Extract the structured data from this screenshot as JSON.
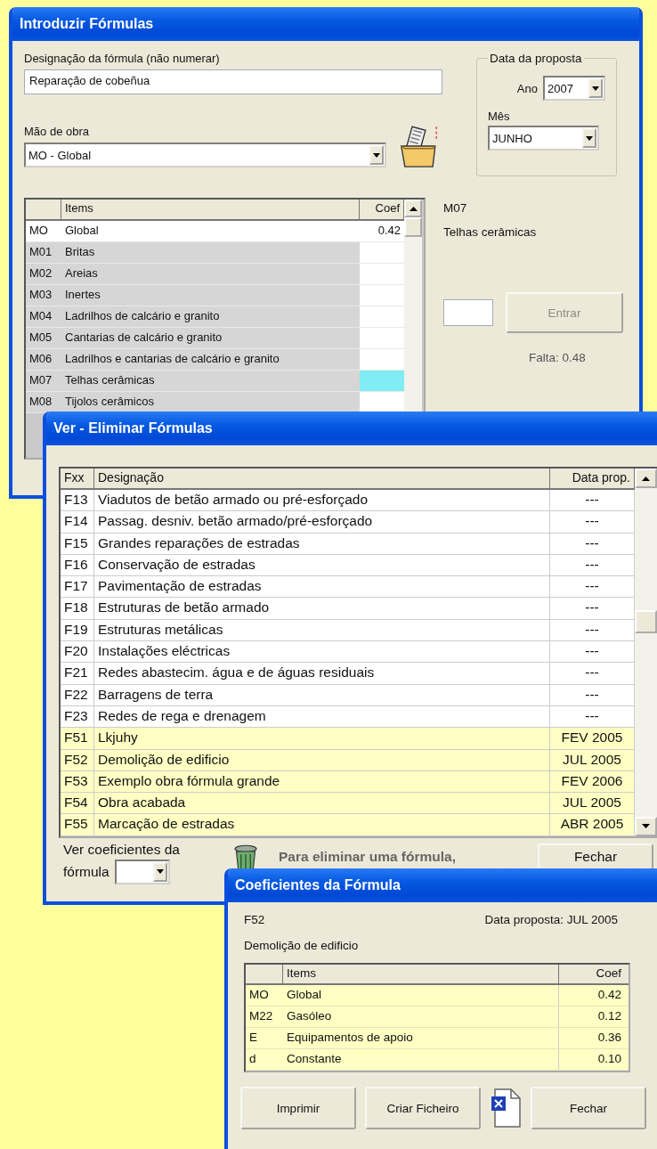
{
  "entry_window": {
    "title": "Introduzir Fórmulas",
    "name_label": "Designação da fórmula (não numerar)",
    "name_value": "Reparação de cobeñua",
    "labor_label": "Mão de obra",
    "labor_value": "MO - Global",
    "date_group": {
      "title": "Data da proposta",
      "year_label": "Ano",
      "year_value": "2007",
      "month_label": "Mês",
      "month_value": "JUNHO"
    },
    "items_table": {
      "columns": [
        "Items",
        "Coef"
      ],
      "rows": [
        {
          "code": "MO",
          "name": "Global",
          "coef": "0.42",
          "selected": false
        },
        {
          "code": "M01",
          "name": "Britas",
          "selected": false
        },
        {
          "code": "M02",
          "name": "Areias",
          "selected": false
        },
        {
          "code": "M03",
          "name": "Inertes",
          "selected": false
        },
        {
          "code": "M04",
          "name": "Ladrilhos de calcário e granito",
          "selected": false
        },
        {
          "code": "M05",
          "name": "Cantarias de calcário e granito",
          "selected": false
        },
        {
          "code": "M06",
          "name": "Ladrilhos e cantarias de calcário e granito",
          "selected": false
        },
        {
          "code": "M07",
          "name": "Telhas cerâmicas",
          "selected": true
        },
        {
          "code": "M08",
          "name": "Tijolos cerâmicos",
          "selected": false
        }
      ]
    },
    "current_item": {
      "code": "M07",
      "name": "Telhas cerâmicas"
    },
    "enter_button": {
      "label": "Entrar",
      "disabled": true
    },
    "remaining": "Falta: 0.48"
  },
  "list_window": {
    "title": "Ver - Eliminar Fórmulas",
    "columns": [
      "Fxx",
      "Designação",
      "Data prop."
    ],
    "rows": [
      {
        "code": "F13",
        "name": "Viadutos de betão armado ou pré-esforçado",
        "date": "---",
        "highlighted": false
      },
      {
        "code": "F14",
        "name": "Passag. desniv. betão armado/pré-esforçado",
        "date": "---",
        "highlighted": false
      },
      {
        "code": "F15",
        "name": "Grandes reparações de estradas",
        "date": "---",
        "highlighted": false
      },
      {
        "code": "F16",
        "name": "Conservação de estradas",
        "date": "---",
        "highlighted": false
      },
      {
        "code": "F17",
        "name": "Pavimentação de estradas",
        "date": "---",
        "highlighted": false
      },
      {
        "code": "F18",
        "name": "Estruturas de betão armado",
        "date": "---",
        "highlighted": false
      },
      {
        "code": "F19",
        "name": "Estruturas metálicas",
        "date": "---",
        "highlighted": false
      },
      {
        "code": "F20",
        "name": "Instalações eléctricas",
        "date": "---",
        "highlighted": false
      },
      {
        "code": "F21",
        "name": "Redes abastecim. água e de águas residuais",
        "date": "---",
        "highlighted": false
      },
      {
        "code": "F22",
        "name": "Barragens de terra",
        "date": "---",
        "highlighted": false
      },
      {
        "code": "F23",
        "name": "Redes de rega e drenagem",
        "date": "---",
        "highlighted": false
      },
      {
        "code": "F51",
        "name": "Lkjuhy",
        "date": "FEV 2005",
        "highlighted": true
      },
      {
        "code": "F52",
        "name": "Demolição de edificio",
        "date": "JUL 2005",
        "highlighted": true
      },
      {
        "code": "F53",
        "name": "Exemplo obra fórmula grande",
        "date": "FEV 2006",
        "highlighted": true
      },
      {
        "code": "F54",
        "name": "Obra acabada",
        "date": "JUL 2005",
        "highlighted": true
      },
      {
        "code": "F55",
        "name": "Marcação de estradas",
        "date": "ABR 2005",
        "highlighted": true
      }
    ],
    "view_label": "Ver coeficientes da",
    "view_label_2": "fórmula",
    "hint": "Para eliminar uma fórmula,",
    "close_button": "Fechar"
  },
  "coef_window": {
    "title": "Coeficientes da Fórmula",
    "code": "F52",
    "date": "Data proposta: JUL 2005",
    "name": "Demolição de edificio",
    "columns": [
      "Items",
      "Coef"
    ],
    "rows": [
      {
        "code": "MO",
        "name": "Global",
        "coef": "0.42"
      },
      {
        "code": "M22",
        "name": "Gasóleo",
        "coef": "0.12"
      },
      {
        "code": "E",
        "name": "Equipamentos de apoio",
        "coef": "0.36"
      },
      {
        "code": "d",
        "name": "Constante",
        "coef": "0.10"
      }
    ],
    "buttons": [
      "Imprimir",
      "Criar Ficheiro",
      "Fechar"
    ]
  }
}
